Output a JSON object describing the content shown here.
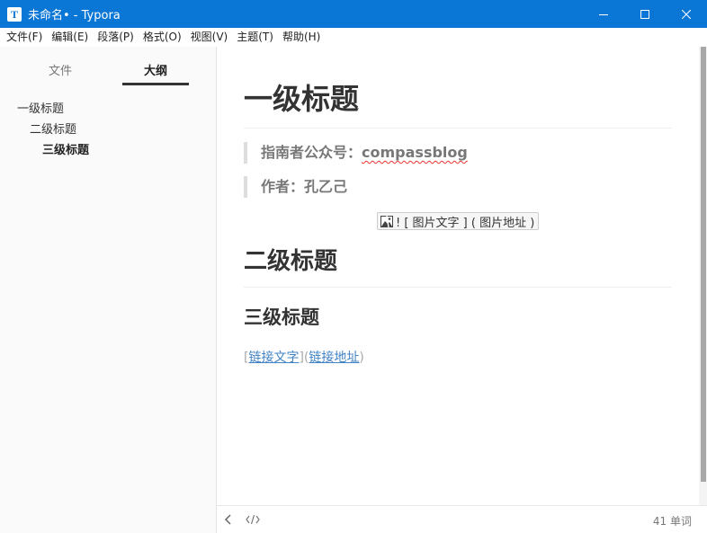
{
  "window": {
    "title": "未命名• - Typora",
    "app_icon_letter": "T"
  },
  "menu": [
    {
      "label": "文件(F)"
    },
    {
      "label": "编辑(E)"
    },
    {
      "label": "段落(P)"
    },
    {
      "label": "格式(O)"
    },
    {
      "label": "视图(V)"
    },
    {
      "label": "主题(T)"
    },
    {
      "label": "帮助(H)"
    }
  ],
  "sidebar": {
    "tabs": {
      "files": "文件",
      "outline": "大纲"
    },
    "outline": [
      {
        "label": "一级标题",
        "level": 1
      },
      {
        "label": "二级标题",
        "level": 2
      },
      {
        "label": "三级标题",
        "level": 3
      }
    ]
  },
  "document": {
    "h1": "一级标题",
    "quote1_prefix": "指南者公众号：",
    "quote1_word": "compassblog",
    "quote2": "作者：孔乙己",
    "image_placeholder": "! [ 图片文字 ] ( 图片地址 )",
    "h2": "二级标题",
    "h3": "三级标题",
    "link_open": "[",
    "link_text": "链接文字",
    "link_mid": "](",
    "link_url": "链接地址",
    "link_close": ")"
  },
  "footer": {
    "back_icon": "chevron-left-icon",
    "source_icon": "code-icon",
    "word_count": "41 单词"
  },
  "colors": {
    "titlebar": "#0a76d6",
    "link": "#4183c4",
    "quote_text": "#777777",
    "spell_error": "#ee3333"
  }
}
